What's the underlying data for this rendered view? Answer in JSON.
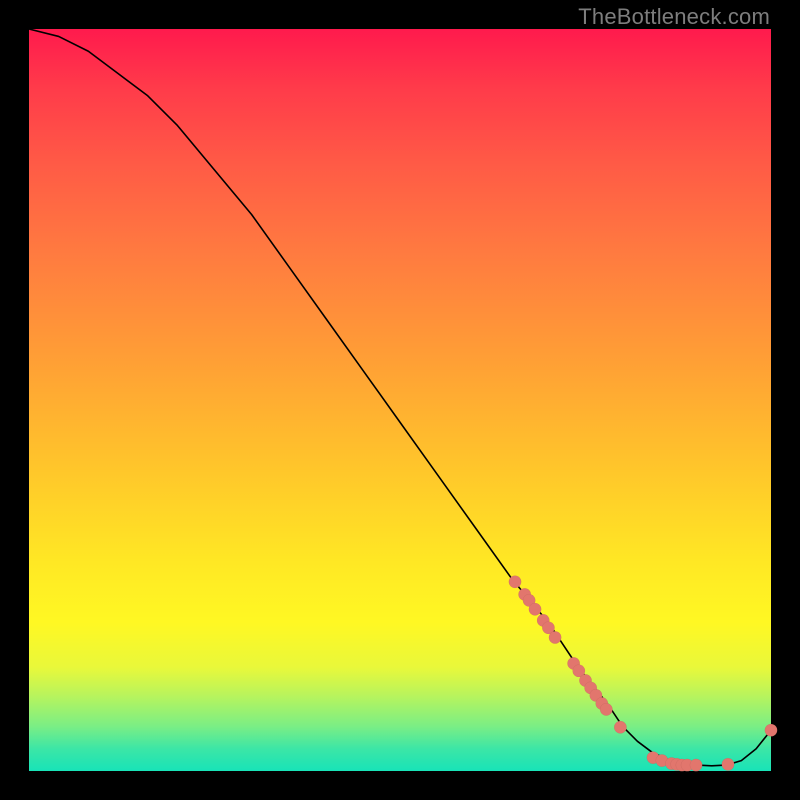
{
  "watermark": "TheBottleneck.com",
  "colors": {
    "gradient_top": "#ff1a4d",
    "gradient_mid": "#ffe824",
    "gradient_bottom": "#18e3b8",
    "curve": "#000000",
    "point_fill": "#e2766d",
    "background": "#000000"
  },
  "chart_data": {
    "type": "line",
    "title": "",
    "xlabel": "",
    "ylabel": "",
    "xlim": [
      0,
      100
    ],
    "ylim": [
      0,
      100
    ],
    "grid": false,
    "legend": false,
    "series": [
      {
        "name": "curve",
        "x": [
          0,
          4,
          8,
          12,
          16,
          20,
          25,
          30,
          35,
          40,
          45,
          50,
          55,
          60,
          65,
          70,
          74,
          78,
          80,
          82,
          84,
          86,
          88,
          90,
          92,
          94,
          96,
          98,
          100
        ],
        "y": [
          100,
          99,
          97,
          94,
          91,
          87,
          81,
          75,
          68,
          61,
          54,
          47,
          40,
          33,
          26,
          20,
          14,
          9,
          6,
          4,
          2.5,
          1.6,
          1.1,
          0.8,
          0.7,
          0.8,
          1.4,
          3.0,
          5.5
        ]
      }
    ],
    "points": [
      {
        "x": 65.5,
        "y": 25.5
      },
      {
        "x": 66.8,
        "y": 23.8
      },
      {
        "x": 67.4,
        "y": 23.0
      },
      {
        "x": 68.2,
        "y": 21.8
      },
      {
        "x": 69.3,
        "y": 20.3
      },
      {
        "x": 70.0,
        "y": 19.3
      },
      {
        "x": 70.9,
        "y": 18.0
      },
      {
        "x": 73.4,
        "y": 14.5
      },
      {
        "x": 74.1,
        "y": 13.5
      },
      {
        "x": 75.0,
        "y": 12.2
      },
      {
        "x": 75.7,
        "y": 11.2
      },
      {
        "x": 76.4,
        "y": 10.2
      },
      {
        "x": 77.2,
        "y": 9.1
      },
      {
        "x": 77.8,
        "y": 8.3
      },
      {
        "x": 79.7,
        "y": 5.9
      },
      {
        "x": 84.1,
        "y": 1.8
      },
      {
        "x": 85.3,
        "y": 1.4
      },
      {
        "x": 86.6,
        "y": 1.0
      },
      {
        "x": 87.3,
        "y": 0.9
      },
      {
        "x": 88.0,
        "y": 0.8
      },
      {
        "x": 88.7,
        "y": 0.8
      },
      {
        "x": 89.9,
        "y": 0.8
      },
      {
        "x": 94.2,
        "y": 0.9
      },
      {
        "x": 100.0,
        "y": 5.5
      }
    ],
    "point_radius": 6.2
  }
}
